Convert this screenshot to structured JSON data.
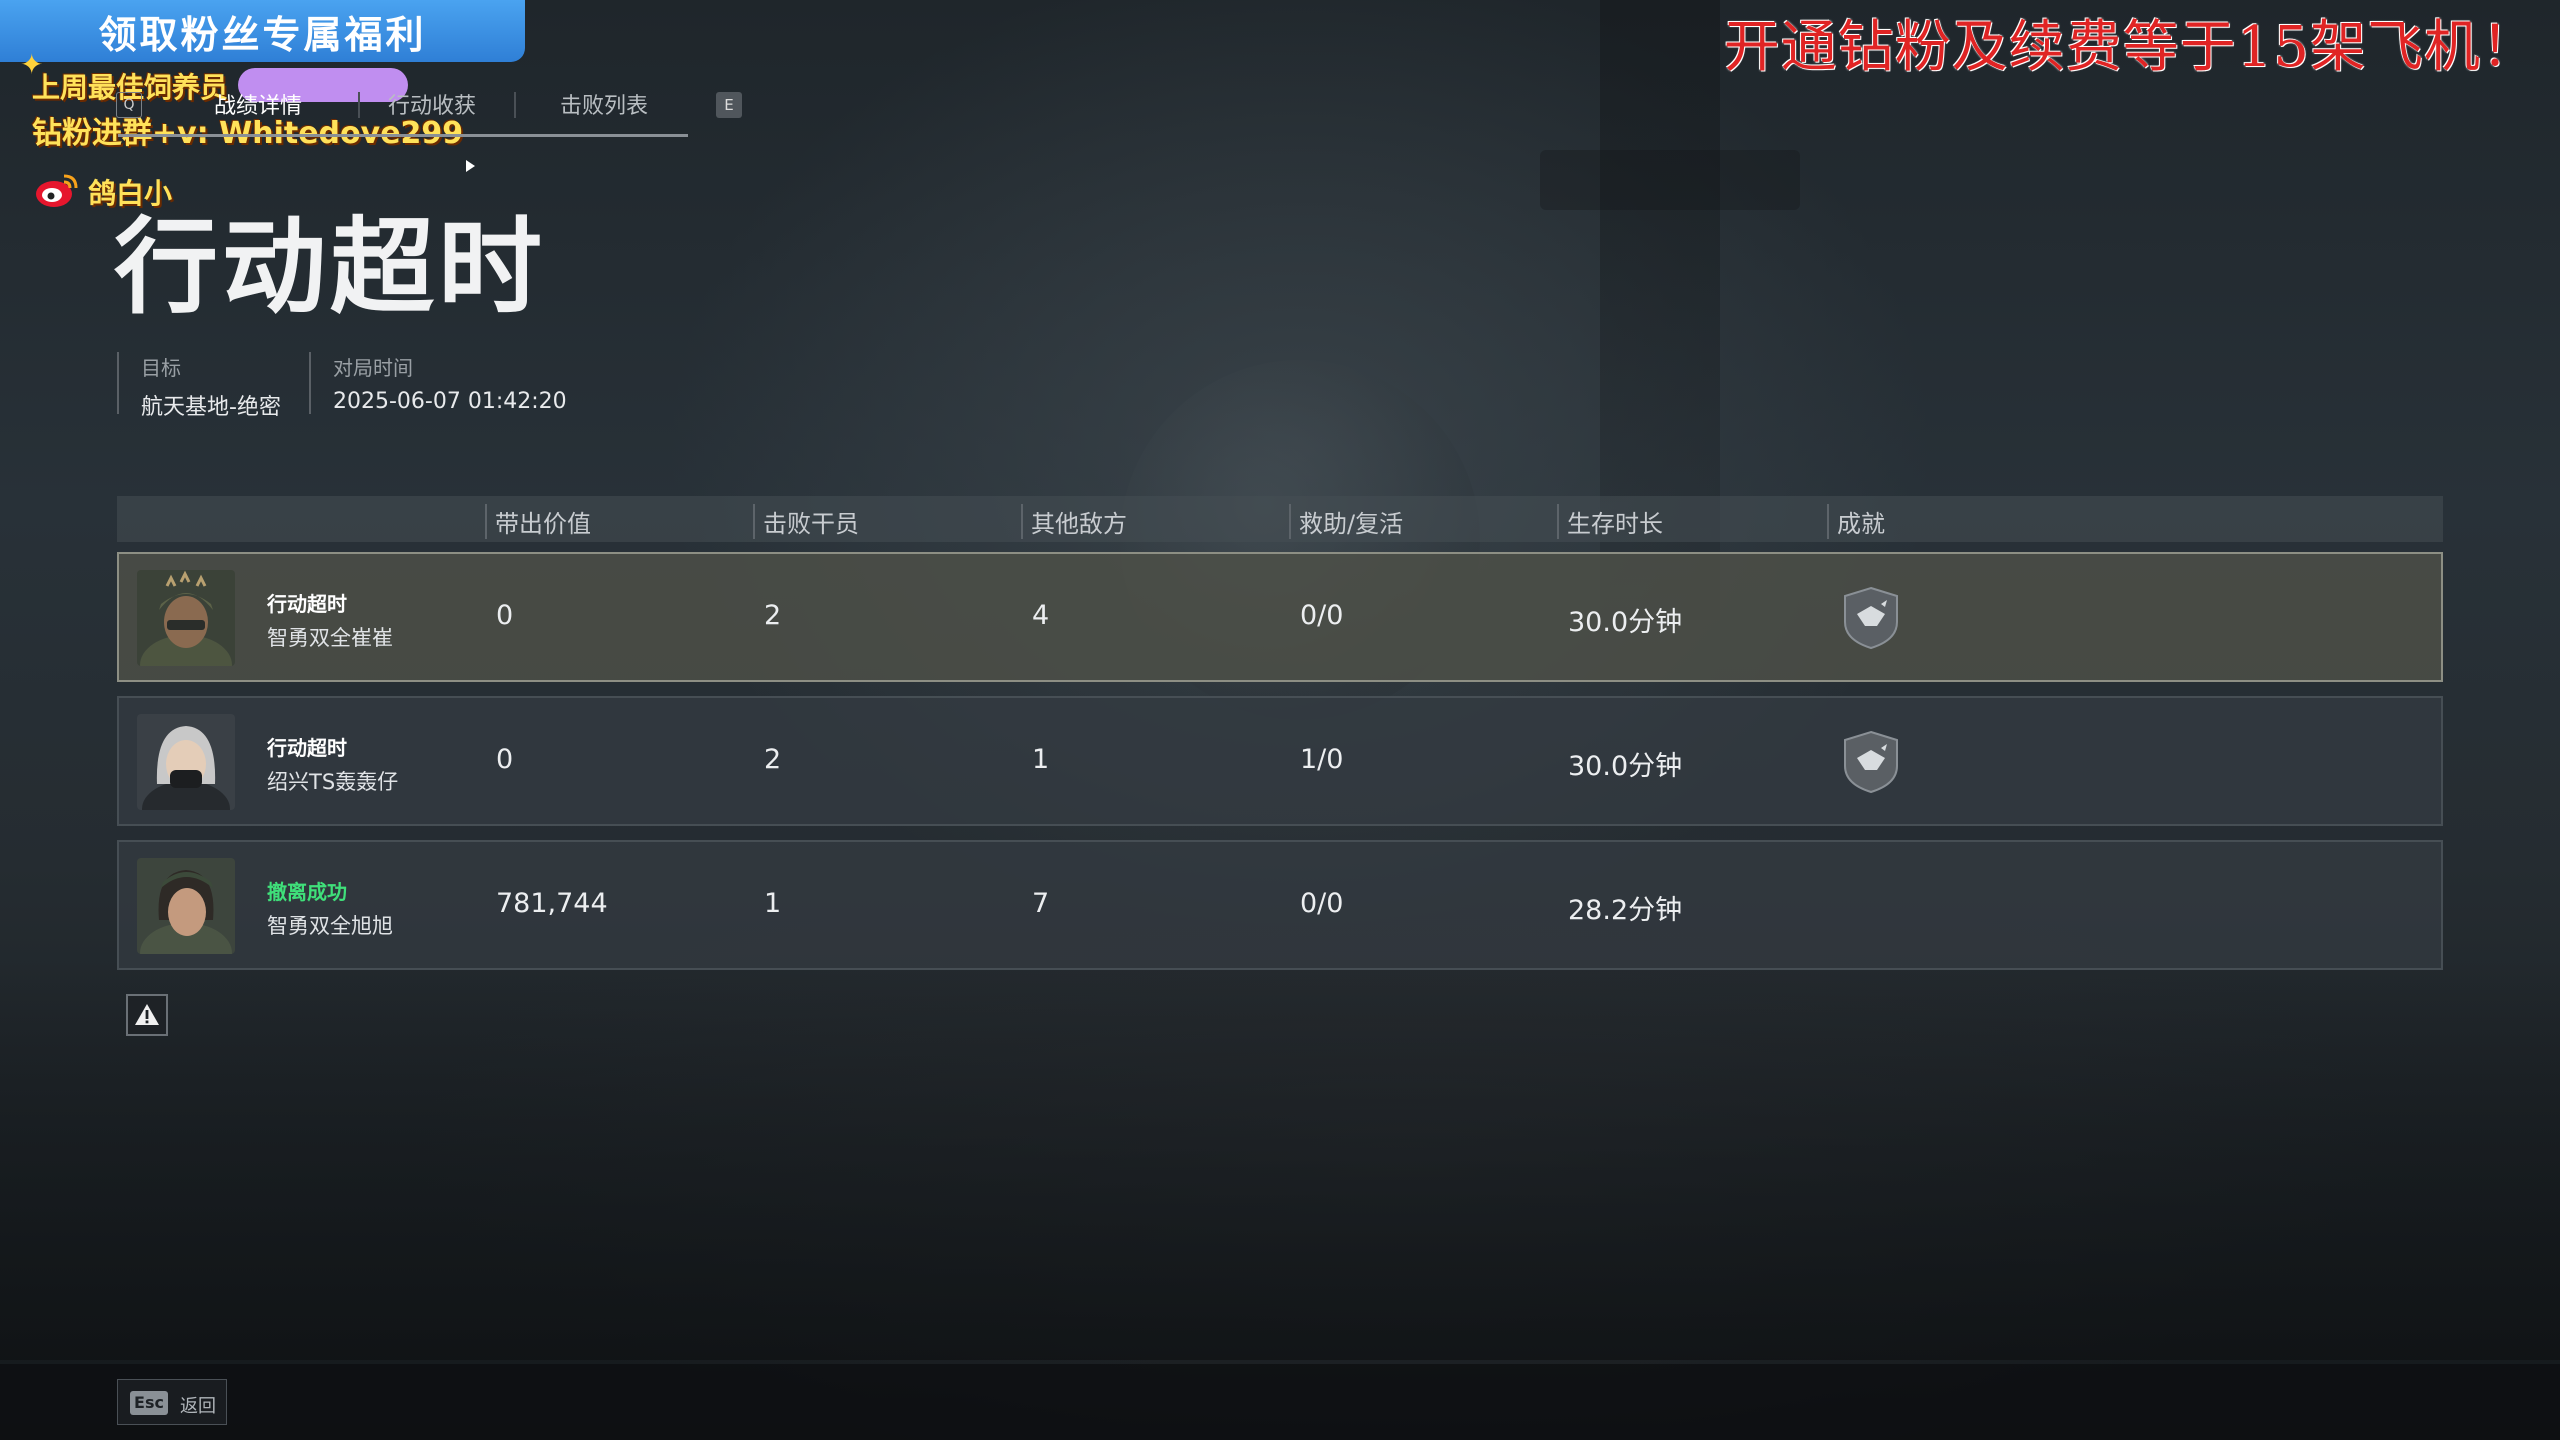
{
  "overlay": {
    "banner": "领取粉丝专属福利",
    "line1": "上周最佳饲养员",
    "line2": "钻粉进群+v: Whitedove299",
    "weibo_name": "鸽白小",
    "right_promo": "开通钻粉及续费等于15架飞机！",
    "accent_blue": "#3a8fe2",
    "accent_yellow": "#ffe25a",
    "accent_red": "#e02424"
  },
  "tabs": [
    {
      "key": "Q",
      "label": "战绩详情",
      "active": true
    },
    {
      "label": "行动收获",
      "active": false
    },
    {
      "label": "击败列表",
      "active": false,
      "key": "E"
    }
  ],
  "title": "行动超时",
  "info": {
    "target_label": "目标",
    "target_value": "航天基地-绝密",
    "time_label": "对局时间",
    "time_value": "2025-06-07 01:42:20"
  },
  "table": {
    "headers": [
      "带出价值",
      "击败干员",
      "其他敌方",
      "救助/复活",
      "生存时长",
      "成就"
    ],
    "rows": [
      {
        "status": "行动超时",
        "name": "智勇双全崔崔",
        "value": "0",
        "kills": "2",
        "others": "4",
        "assist": "0/0",
        "survive": "30.0分钟",
        "badge": "achievement-badge-icon",
        "highlight": true,
        "status_color": "#ffffff"
      },
      {
        "status": "行动超时",
        "name": "绍兴TS轰轰仔",
        "value": "0",
        "kills": "2",
        "others": "1",
        "assist": "1/0",
        "survive": "30.0分钟",
        "badge": "achievement-badge-icon",
        "highlight": false,
        "status_color": "#ffffff"
      },
      {
        "status": "撤离成功",
        "name": "智勇双全旭旭",
        "value": "781,744",
        "kills": "1",
        "others": "7",
        "assist": "0/0",
        "survive": "28.2分钟",
        "badge": "",
        "highlight": false,
        "status_color": "#3fe07a"
      }
    ]
  },
  "footer": {
    "esc_key": "Esc",
    "esc_label": "返回"
  }
}
